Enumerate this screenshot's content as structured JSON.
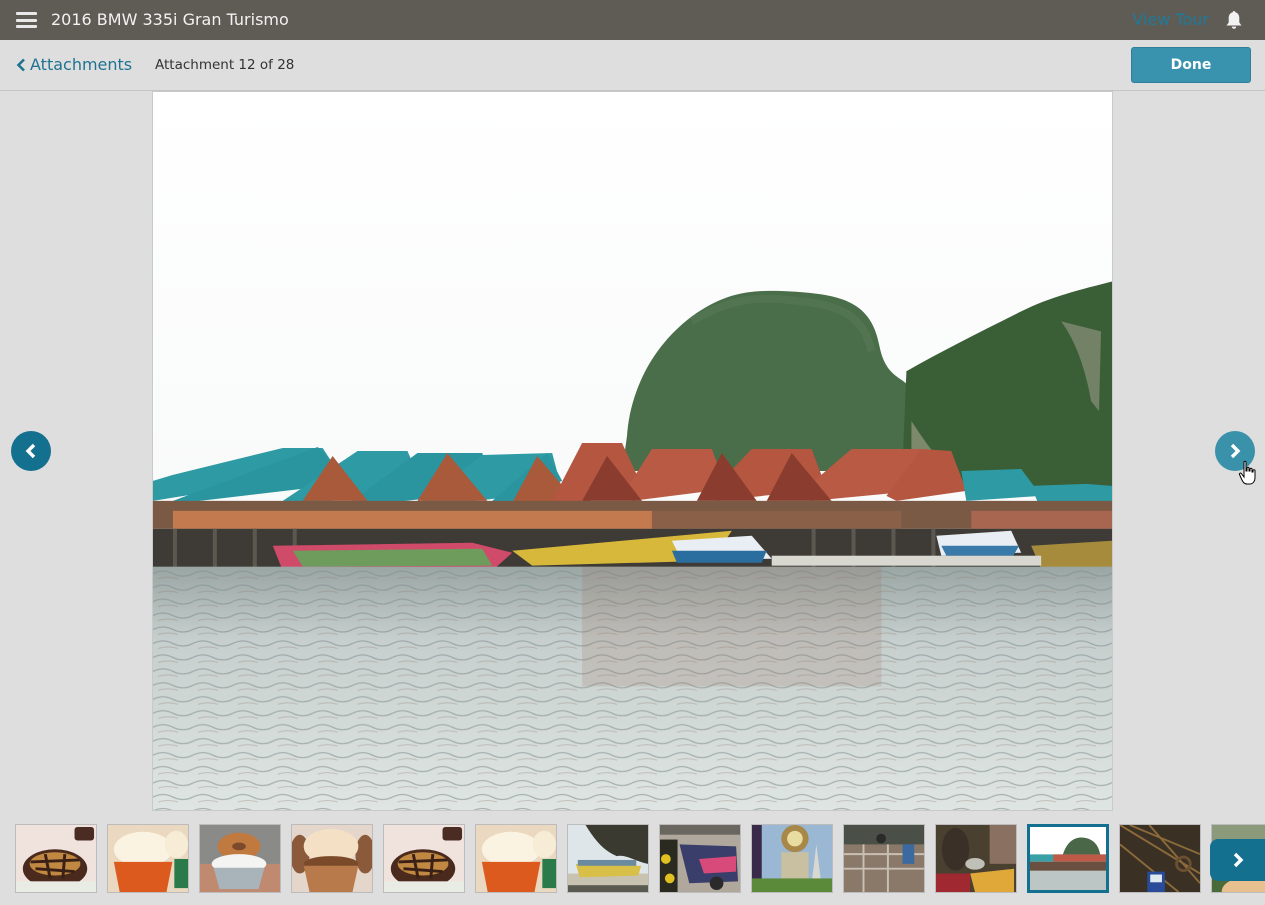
{
  "header": {
    "menu_icon": "hamburger-menu-icon",
    "title": "2016 BMW 335i Gran Turismo",
    "view_tour": "View Tour",
    "notification_icon": "bell-icon"
  },
  "subheader": {
    "back_label": "Attachments",
    "back_icon": "chevron-left-icon",
    "counter": "Attachment 12 of 28",
    "done_label": "Done"
  },
  "viewer": {
    "current_index": 12,
    "total": 28,
    "image_alt": "Stilt village with teal and red roofed buildings on water below karst limestone cliffs",
    "prev_icon": "chevron-left-circle-icon",
    "next_icon": "chevron-right-circle-icon"
  },
  "thumbnails": [
    {
      "subject": "chocolate brownie with caramel",
      "active": false
    },
    {
      "subject": "vanilla cupcake orange wrapper",
      "active": false
    },
    {
      "subject": "donut topped cupcake",
      "active": false
    },
    {
      "subject": "chocolate cupcake cream frosting",
      "active": false
    },
    {
      "subject": "chocolate brownie with caramel",
      "active": false
    },
    {
      "subject": "vanilla cupcake orange wrapper",
      "active": false
    },
    {
      "subject": "longtail boat by limestone cliff",
      "active": false
    },
    {
      "subject": "colorful tuk-tuk",
      "active": false
    },
    {
      "subject": "temple shrine",
      "active": false
    },
    {
      "subject": "market stall scene",
      "active": false
    },
    {
      "subject": "floating market with bananas",
      "active": false
    },
    {
      "subject": "stilt village on water",
      "active": true
    },
    {
      "subject": "tangled wires with sign",
      "active": false
    },
    {
      "subject": "jungle scene",
      "active": false
    }
  ],
  "thumbnail_strip": {
    "next_icon": "chevron-right-icon"
  },
  "colors": {
    "header_bg": "#5f5c56",
    "accent": "#13708e",
    "button": "#3a93ae",
    "link": "#1f7391"
  }
}
